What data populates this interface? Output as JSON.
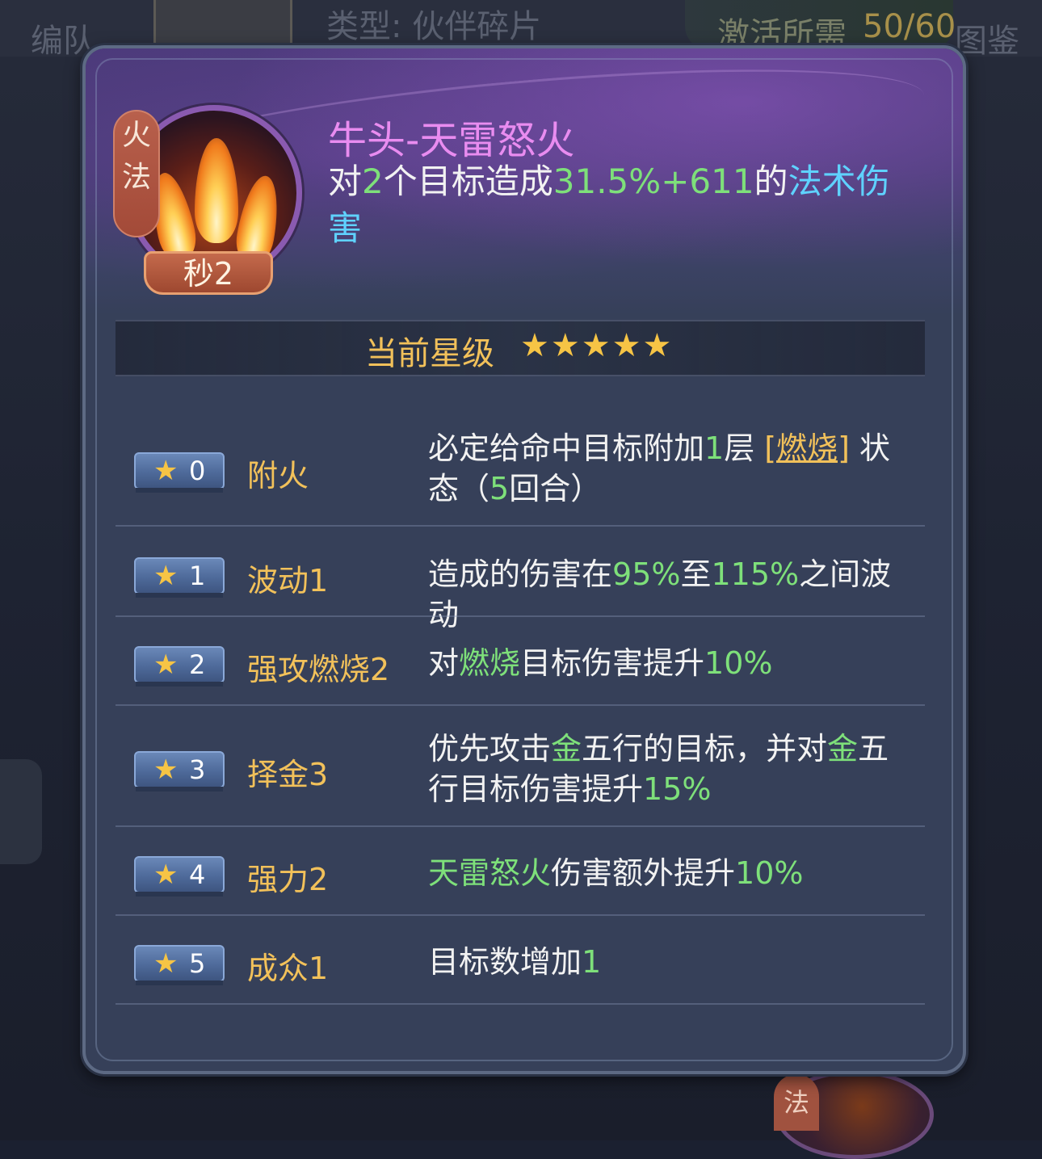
{
  "background": {
    "left_label": "编队",
    "type_label": "类型: 伙伴碎片",
    "need_label": "激活所需",
    "need_value": "50/60",
    "right_label": "图鉴",
    "bottom_tag": "法"
  },
  "skill": {
    "element_tag_1": "火",
    "element_tag_2": "法",
    "banner": "秒2",
    "name": "牛头-天雷怒火",
    "desc": {
      "p1": "对",
      "n1": "2",
      "p2": "个目标造成",
      "n2": "31.5%+611",
      "p3": "的",
      "p4": "法术伤害"
    }
  },
  "star_level": {
    "label": "当前星级",
    "stars": "★★★★★",
    "count": 5
  },
  "traits": [
    {
      "level": "0",
      "name": "附火",
      "effect": {
        "a": "必定给命中目标附加",
        "b": "1",
        "c": "层 ",
        "d": "[燃烧]",
        "e": " 状态（",
        "f": "5",
        "g": "回合）"
      }
    },
    {
      "level": "1",
      "name": "波动1",
      "effect": {
        "a": "造成的伤害在",
        "b": "95%",
        "c": "至",
        "d": "115%",
        "e": "之间波动"
      }
    },
    {
      "level": "2",
      "name": "强攻燃烧2",
      "effect": {
        "a": "对",
        "b": "燃烧",
        "c": "目标伤害提升",
        "d": "10%"
      }
    },
    {
      "level": "3",
      "name": "择金3",
      "effect": {
        "a": "优先攻击",
        "b": "金",
        "c": "五行的目标，并对",
        "d": "金",
        "e": "五行目标伤害提升",
        "f": "15%"
      }
    },
    {
      "level": "4",
      "name": "强力2",
      "effect": {
        "a": "天雷怒火",
        "b": "伤害额外提升",
        "c": "10%"
      }
    },
    {
      "level": "5",
      "name": "成众1",
      "effect": {
        "a": "目标数增加",
        "b": "1"
      }
    }
  ],
  "colors": {
    "gold": "#f2c15a",
    "green": "#7ee07a",
    "blue": "#5fd2ff",
    "name_pink": "#e98cf0"
  }
}
